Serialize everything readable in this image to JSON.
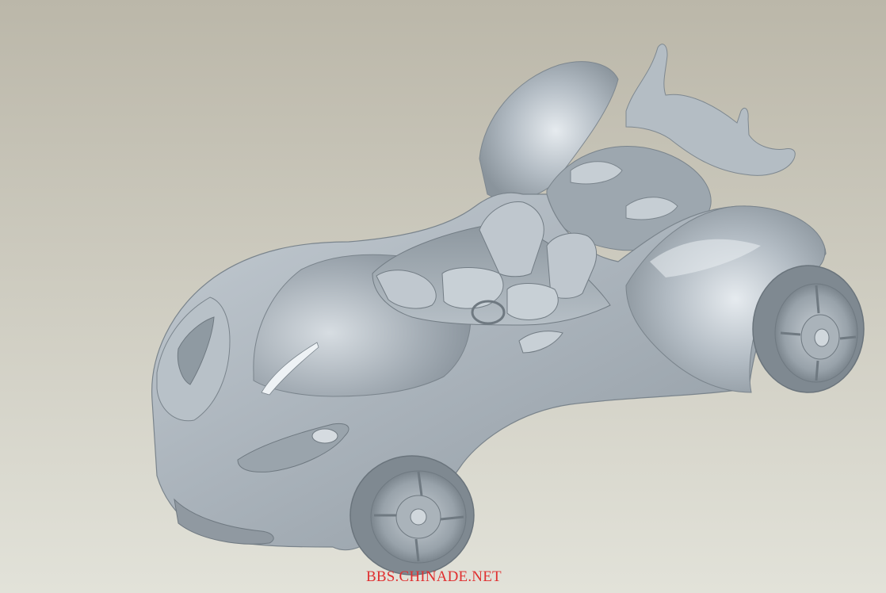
{
  "viewport": {
    "background_top": "#bbb6a8",
    "background_bottom": "#e1e1d8",
    "model_color": "#a9b2ba",
    "model_highlight": "#eef2f5",
    "model_shadow": "#6e7880"
  },
  "watermark": {
    "text": "BBS.CHINADE.NET",
    "color": "#e03030"
  }
}
